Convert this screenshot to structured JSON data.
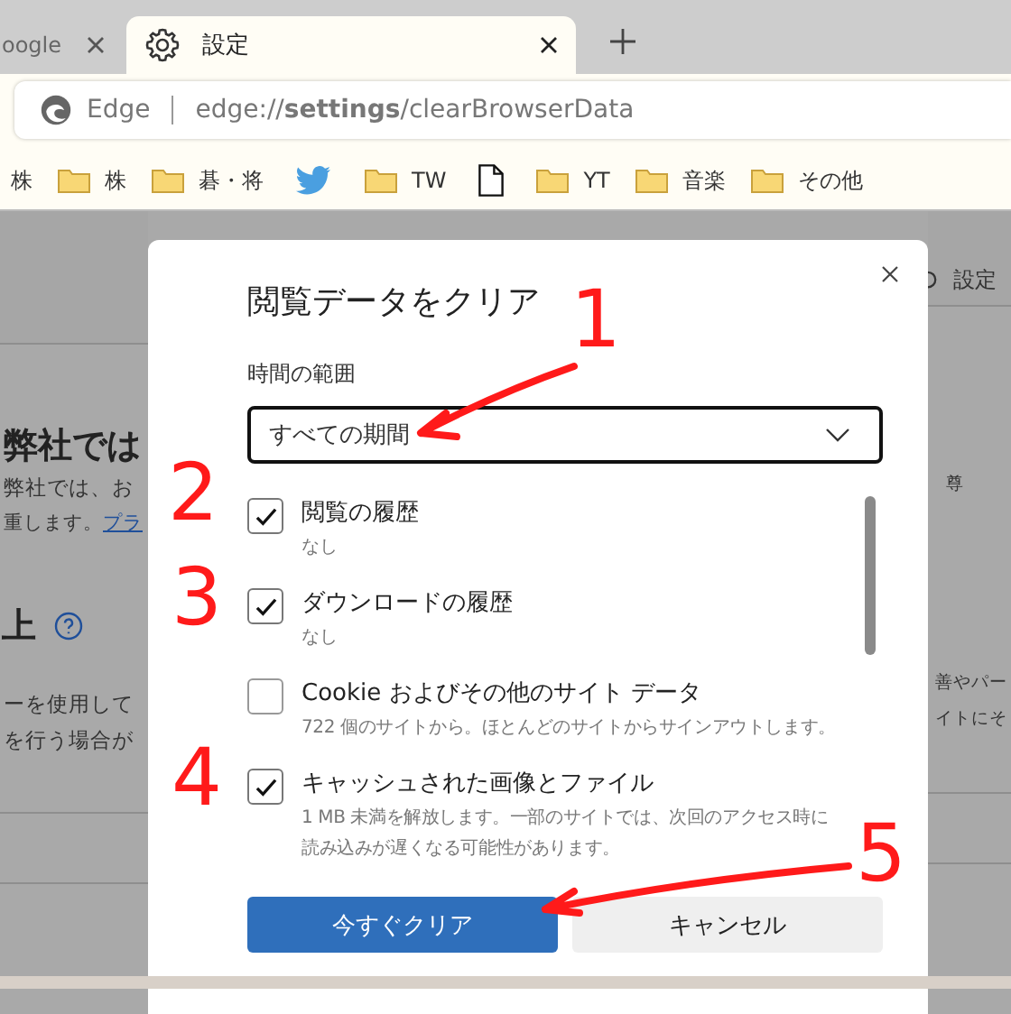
{
  "tabs": [
    {
      "title": "oogle",
      "selected": false
    },
    {
      "title": "設定",
      "selected": true
    }
  ],
  "address_bar": {
    "brand": "Edge",
    "url": "edge://**settings**/clearBrowserData"
  },
  "bookmarks": [
    {
      "kind": "text",
      "label": "株"
    },
    {
      "kind": "folder",
      "label": "株"
    },
    {
      "kind": "folder",
      "label": "碁・将"
    },
    {
      "kind": "bird"
    },
    {
      "kind": "folder",
      "label": "TW"
    },
    {
      "kind": "page"
    },
    {
      "kind": "folder",
      "label": "YT"
    },
    {
      "kind": "folder",
      "label": "音楽"
    },
    {
      "kind": "folder",
      "label": "その他"
    }
  ],
  "background_page": {
    "heading": "弊社では",
    "text_1": "弊社では、お",
    "text_2": "重します。",
    "link": "プラ",
    "section_title": "上",
    "text_3": "ーを使用して",
    "text_4": "を行う場合が",
    "right_top": "設定",
    "right_1": "尊",
    "right_2": "善やパー",
    "right_3": "イトにそ"
  },
  "dialog": {
    "title": "閲覧データをクリア",
    "range_label": "時間の範囲",
    "range_value": "すべての期間",
    "items": [
      {
        "label": "閲覧の履歴",
        "description": "なし",
        "checked": true
      },
      {
        "label": "ダウンロードの履歴",
        "description": "なし",
        "checked": true
      },
      {
        "label": "Cookie およびその他のサイト データ",
        "description": "722 個のサイトから。ほとんどのサイトからサインアウトします。",
        "checked": false
      },
      {
        "label": "キャッシュされた画像とファイル",
        "description": "1 MB 未満を解放します。一部のサイトでは、次回のアクセス時に読み込みが遅くなる可能性があります。",
        "checked": true
      }
    ],
    "buttons": [
      {
        "label": "今すぐクリア",
        "kind": "primary"
      },
      {
        "label": "キャンセル",
        "kind": "secondary"
      }
    ]
  },
  "annotations": [
    "1",
    "2",
    "3",
    "4",
    "5"
  ]
}
